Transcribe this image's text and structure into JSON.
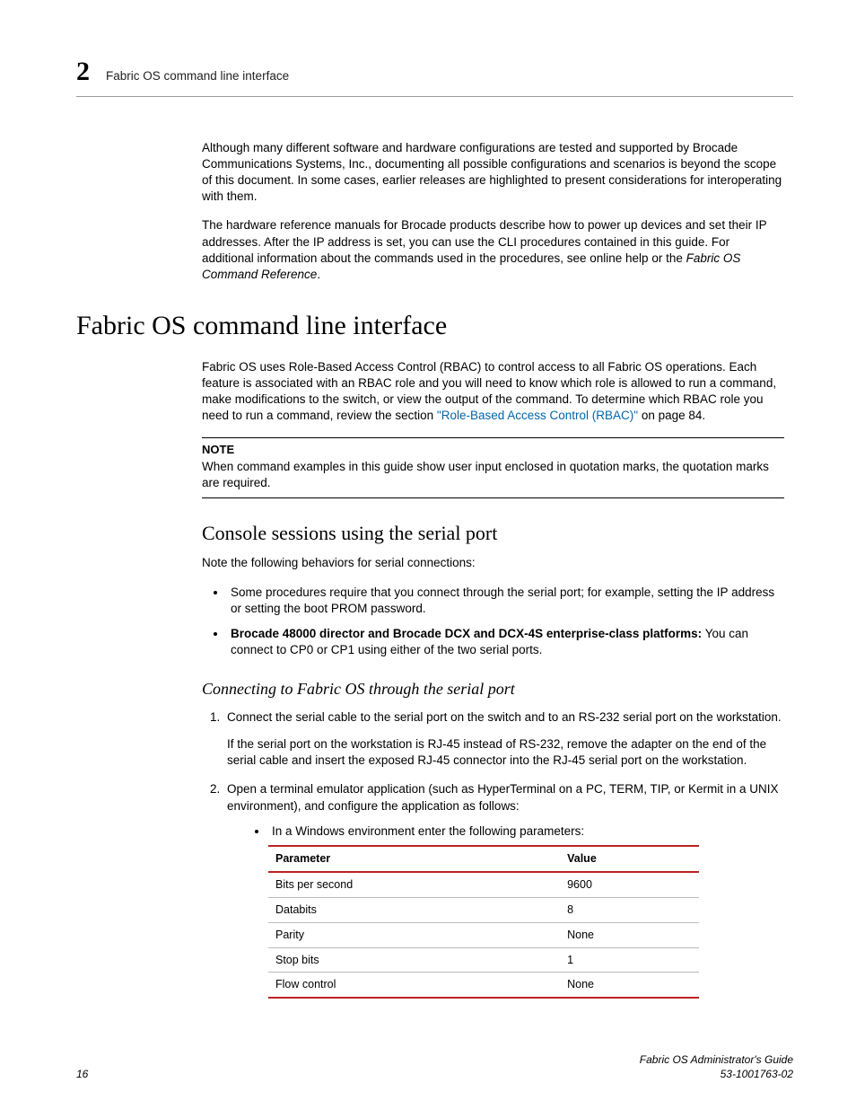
{
  "header": {
    "chapter_number": "2",
    "running_title": "Fabric OS command line interface"
  },
  "intro": {
    "p1": "Although many different software and hardware configurations are tested and supported by Brocade Communications Systems, Inc., documenting all possible configurations and scenarios is beyond the scope of this document. In some cases, earlier releases are highlighted to present considerations for interoperating with them.",
    "p2_a": "The hardware reference manuals for Brocade products describe how to power up devices and set their IP addresses. After the IP address is set, you can use the CLI procedures contained in this guide. For additional information about the commands used in the procedures, see online help or the ",
    "p2_ref": "Fabric OS Command Reference",
    "p2_b": "."
  },
  "section": {
    "title": "Fabric OS command line interface",
    "p1_a": "Fabric OS uses Role-Based Access Control (RBAC) to control access to all Fabric OS operations. Each feature is associated with an RBAC role and you will need to know which role is allowed to run a command, make modifications to the switch, or view the output of the command. To determine which RBAC role you need to run a command, review the section ",
    "p1_link": "\"Role-Based Access Control (RBAC)\"",
    "p1_b": " on page 84.",
    "note_label": "NOTE",
    "note_body": "When command examples in this guide show user input enclosed in quotation marks, the quotation marks are required."
  },
  "console": {
    "title": "Console sessions using the serial port",
    "intro": "Note the following behaviors for serial connections:",
    "bullets": [
      {
        "text": "Some procedures require that you connect through the serial port; for example, setting the IP address or setting the boot PROM password."
      },
      {
        "bold": "Brocade 48000 director and Brocade DCX and DCX-4S enterprise-class platforms:",
        "rest": " You can connect to CP0 or CP1 using either of the two serial ports."
      }
    ]
  },
  "connect": {
    "title": "Connecting to Fabric OS through the serial port",
    "steps": {
      "s1a": "Connect the serial cable to the serial port on the switch and to an RS-232 serial port on the workstation.",
      "s1b": "If the serial port on the workstation is RJ-45 instead of RS-232, remove the adapter on the end of the serial cable and insert the exposed RJ-45 connector into the RJ-45 serial port on the workstation.",
      "s2": "Open a terminal emulator application (such as HyperTerminal on a PC, TERM, TIP, or Kermit in a UNIX environment), and configure the application as follows:",
      "s2_sub": "In a Windows environment enter the following parameters:"
    },
    "table": {
      "headers": [
        "Parameter",
        "Value"
      ],
      "rows": [
        [
          "Bits per second",
          "9600"
        ],
        [
          "Databits",
          "8"
        ],
        [
          "Parity",
          "None"
        ],
        [
          "Stop bits",
          "1"
        ],
        [
          "Flow control",
          "None"
        ]
      ]
    }
  },
  "footer": {
    "page": "16",
    "doc_title": "Fabric OS Administrator's Guide",
    "doc_num": "53-1001763-02"
  }
}
